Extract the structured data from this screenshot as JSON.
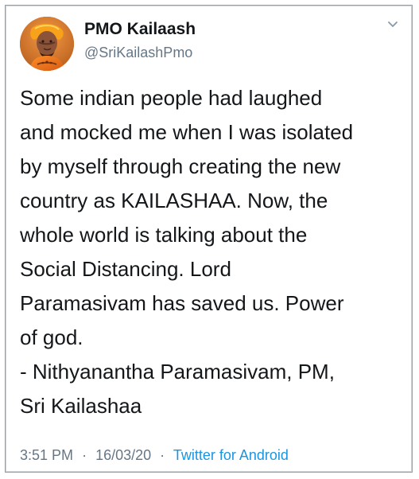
{
  "tweet": {
    "author": {
      "display_name": "PMO Kailaash",
      "handle": "@SriKailashPmo"
    },
    "text_lines": [
      "Some indian people had laughed",
      "and mocked me when I was isolated",
      "by myself through creating the new",
      "country as KAILASHAA. Now, the",
      "whole world is talking about the",
      "Social Distancing. Lord",
      "Paramasivam has saved us. Power",
      "of god.",
      "- Nithyanantha Paramasivam, PM,",
      "Sri Kailashaa"
    ],
    "meta": {
      "time": "3:51 PM",
      "separator": "·",
      "date": "16/03/20",
      "source": "Twitter for Android"
    }
  },
  "icons": {
    "caret": "chevron-down-icon"
  },
  "colors": {
    "primary_text": "#14171a",
    "secondary_text": "#657786",
    "link": "#1b95e0",
    "border": "#9a9fa4",
    "background": "#ffffff"
  }
}
